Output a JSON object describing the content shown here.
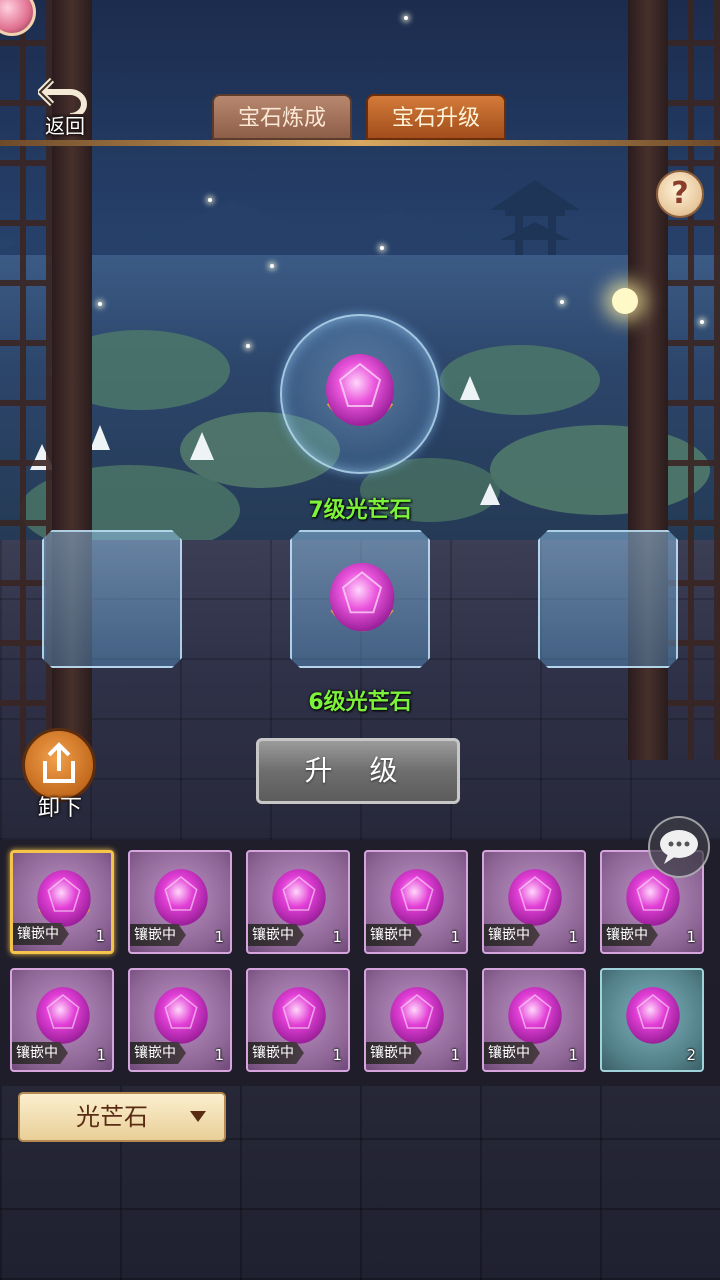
{
  "nav": {
    "back_label": "返回"
  },
  "tabs": [
    {
      "label": "宝石炼成",
      "active": false
    },
    {
      "label": "宝石升级",
      "active": true
    }
  ],
  "help": {
    "icon": "question-icon",
    "label": "?"
  },
  "crafting": {
    "result_name": "7级光芒石",
    "material_name": "6级光芒石",
    "upgrade_label": "升 级",
    "unload_label": "卸下"
  },
  "inventory": {
    "items": [
      {
        "tag": "镶嵌中",
        "count": "1",
        "selected": true
      },
      {
        "tag": "镶嵌中",
        "count": "1",
        "selected": false
      },
      {
        "tag": "镶嵌中",
        "count": "1",
        "selected": false
      },
      {
        "tag": "镶嵌中",
        "count": "1",
        "selected": false
      },
      {
        "tag": "镶嵌中",
        "count": "1",
        "selected": false
      },
      {
        "tag": "镶嵌中",
        "count": "1",
        "selected": false
      },
      {
        "tag": "镶嵌中",
        "count": "1",
        "selected": false
      },
      {
        "tag": "镶嵌中",
        "count": "1",
        "selected": false
      },
      {
        "tag": "镶嵌中",
        "count": "1",
        "selected": false
      },
      {
        "tag": "镶嵌中",
        "count": "1",
        "selected": false
      },
      {
        "tag": "镶嵌中",
        "count": "1",
        "selected": false
      },
      {
        "tag": "",
        "count": "2",
        "selected": false
      }
    ]
  },
  "filter": {
    "label": "光芒石"
  },
  "colors": {
    "accent_green": "#7df23a",
    "gem_pink": "#e23fd6",
    "tab_active": "#c2652a",
    "selected_border": "#f6c44a"
  }
}
